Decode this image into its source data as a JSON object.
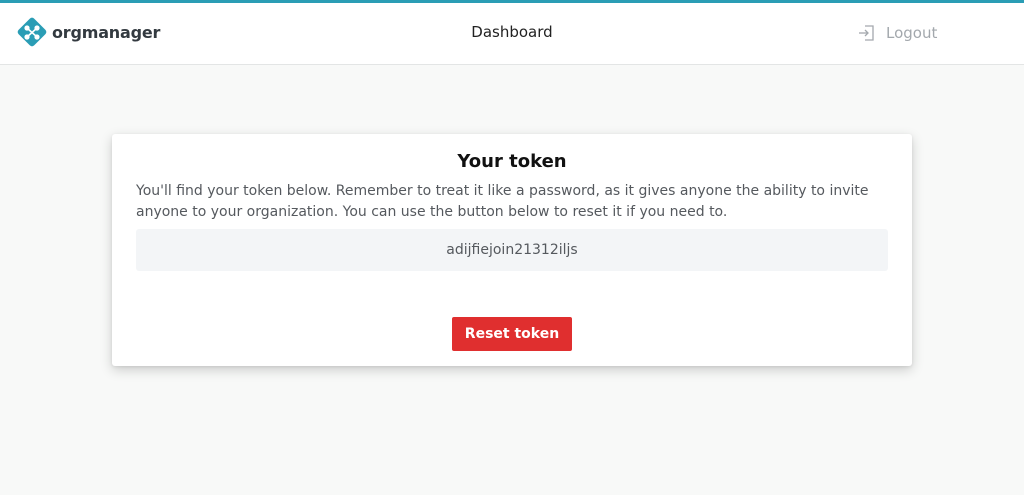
{
  "app": {
    "logo_text": "orgmanager",
    "brand_color": "#2a9db5"
  },
  "nav": {
    "dashboard_label": "Dashboard",
    "logout_label": "Logout",
    "logout_icon": "sign-out-icon"
  },
  "token_card": {
    "title": "Your token",
    "description": "You'll find your token below. Remember to treat it like a password, as it gives anyone the ability to invite anyone to your organization. You can use the button below to reset it if you need to.",
    "token_value": "adijfiejoin21312iljs",
    "reset_button_label": "Reset token",
    "reset_button_color": "#e02f2f"
  }
}
